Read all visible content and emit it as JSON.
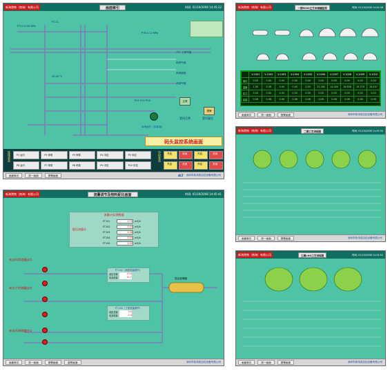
{
  "company": "新海港南（南海）有限公司",
  "panels": [
    {
      "title": "画面索引",
      "time": "时间: 01/19/2008 14:45:22",
      "banner": "码头监控系统画面",
      "buttons": {
        "normal": "正常",
        "alarm": "报警",
        "indoor_normal": "室内正常",
        "indoor_reset": "室内复位",
        "local_run": "本地运行（中标准）"
      },
      "pump_rows": [
        "P1",
        "P2",
        "P3",
        "P4",
        "P5",
        "P6",
        "P7",
        "P8",
        "P9",
        "P10"
      ],
      "pump_state": [
        "运行",
        "停泵",
        "停泵",
        "中控",
        "中控"
      ],
      "side_left": "现场状态",
      "side_right": "中控状态",
      "side_right_btns": [
        "开启",
        "关闭",
        "开启",
        "关闭"
      ],
      "nav": [
        "画面索引",
        "前一画面",
        "报警画面"
      ],
      "footer_logo": "ALT",
      "footer": "深圳市新鸿成自控设备有限公司"
    },
    {
      "title": "一期5000立方米储罐监视",
      "time": "时间: 01/19/2008 14:45:38",
      "table_header": [
        "V-1001",
        "V-1002",
        "V-1003",
        "V-1004",
        "V-1005",
        "V-1006",
        "V-1007",
        "V-1008",
        "V-1009",
        "V-1010"
      ],
      "table_rows": [
        {
          "label": "液位",
          "values": [
            "0.00",
            "0.00",
            "0.00",
            "0.00",
            "0.00",
            "0.00",
            "0.00",
            "0.00",
            "0.00",
            "0.00"
          ]
        },
        {
          "label": "温度",
          "values": [
            "1.00",
            "5.36",
            "0.00",
            "0.00",
            "0.00",
            "21.182",
            "14.000",
            "18.658",
            "19.374",
            "16.457"
          ]
        },
        {
          "label": "压力",
          "values": [
            "0.00",
            "0.00",
            "0.00",
            "0.00",
            "0.00",
            "0.00",
            "0.00",
            "0.00",
            "0.00",
            "0.00"
          ]
        },
        {
          "label": "容量",
          "values": [
            "0.06",
            "0.06",
            "0.06",
            "0.06",
            "0.06",
            "0.06",
            "0.06",
            "0.06",
            "0.06",
            "0.06"
          ]
        }
      ],
      "nav": [
        "画面索引",
        "前一画面",
        "报警画面"
      ],
      "footer": "深圳市新鸿成自控设备有限公司"
    },
    {
      "title": "流量调节及物料配比画面",
      "time": "时间: 01/19/2008 14:45:41",
      "center_header": "流量计实测数据",
      "center_label": "配比流量计",
      "center_rows": [
        {
          "tag": "FT101",
          "value": "1.70",
          "unit": "m3/h"
        },
        {
          "tag": "FT102",
          "value": "0.00",
          "unit": "m3/h"
        },
        {
          "tag": "FT103",
          "value": "1.08",
          "unit": "m3/h"
        },
        {
          "tag": "FT104",
          "value": "0.00",
          "unit": "m3/h"
        },
        {
          "tag": "FT105",
          "value": "1.00",
          "unit": "m3/h"
        }
      ],
      "left_groups": [
        "来自丙烷储罐出口",
        "来自丁烷储罐出口",
        "来自丙烯储罐出口"
      ],
      "regulators": [
        {
          "title": "FT-101（丙烷流量调节）",
          "set": "设定流量",
          "set_val": "13.6",
          "actual": "实测流量",
          "actual_val": "14.7"
        },
        {
          "title": "FT-102（丁烷流量调节）",
          "set": "设定流量",
          "set_val": "0.0",
          "actual": "实测流量",
          "actual_val": "0.0"
        }
      ],
      "mixer_label": "混合液储罐",
      "nav": [
        "画面索引",
        "前一画面",
        "报警画面",
        "趋势画面"
      ],
      "footer": "深圳市新鸿成自控设备有限公司"
    },
    {
      "title": "二期工艺流程图",
      "time": "时间: 01/19/2008 14:45:30",
      "nav": [
        "画面索引",
        "前一画面",
        "报警画面"
      ],
      "footer": "深圳市新鸿成自控设备有限公司"
    },
    {
      "title": "三期LNG工艺流程图",
      "time": "时间: 01/19/2008 14:45:52",
      "nav": [
        "画面索引",
        "前一画面",
        "报警画面"
      ],
      "footer": "深圳市新鸿成自控设备有限公司"
    }
  ]
}
